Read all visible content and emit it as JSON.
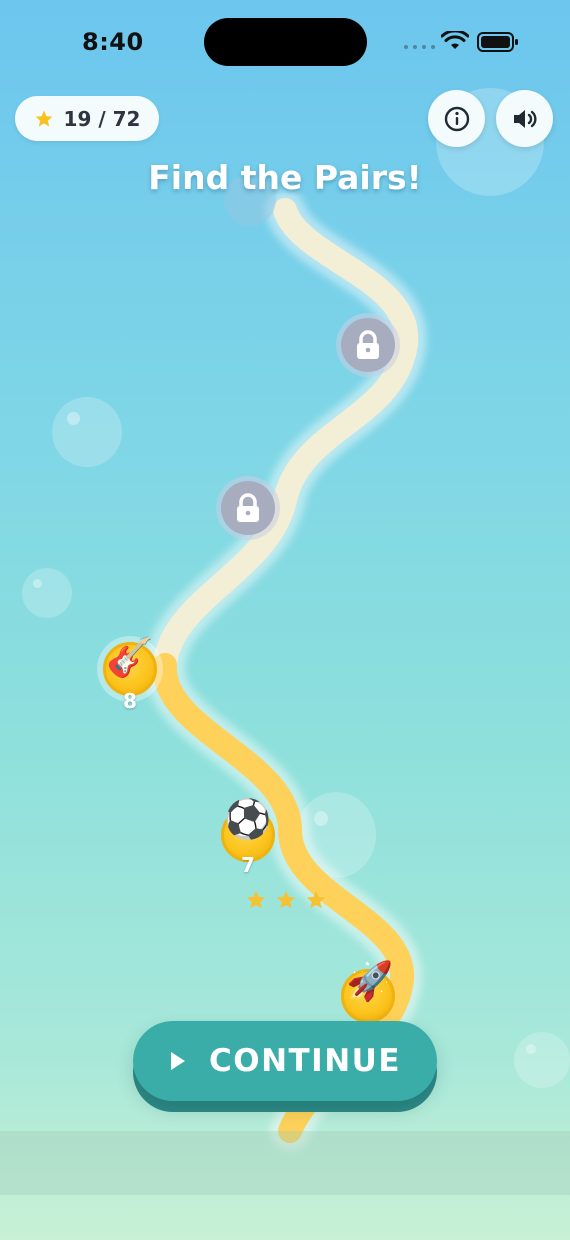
{
  "status_bar": {
    "time": "8:40"
  },
  "header": {
    "stars_count": "19 / 72",
    "info_button": "info-icon",
    "sound_button": "speaker-icon"
  },
  "title": "Find the Pairs!",
  "levels": [
    {
      "number": "8",
      "emoji": "🎸",
      "state": "current"
    },
    {
      "number": "7",
      "emoji": "⚽",
      "state": "completed",
      "stars": 3
    },
    {
      "number": "",
      "emoji": "🚀",
      "state": "completed"
    }
  ],
  "locked_levels": 2,
  "continue_button": {
    "label": "CONTINUE"
  },
  "colors": {
    "accent": "#3aada8",
    "coin": "#fbc21a",
    "path_done": "#fdd15a",
    "path_todo": "#f3eed6",
    "lock": "#a7adbf"
  }
}
